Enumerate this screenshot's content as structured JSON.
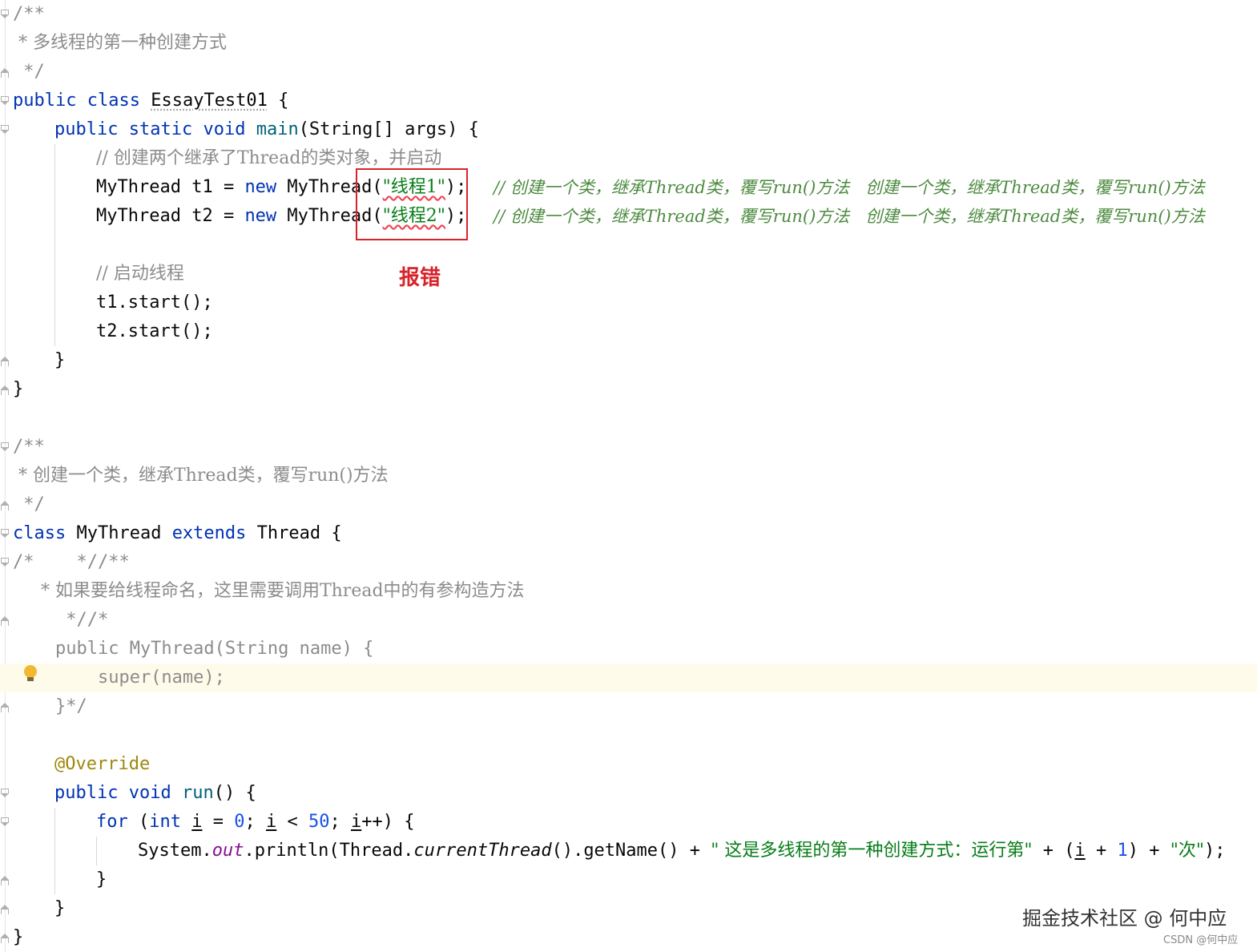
{
  "code": {
    "l1": "/**",
    "l2": " * 多线程的第一种创建方式",
    "l3": " */",
    "l4_public": "public",
    "l4_class": "class",
    "l4_name": "EssayTest01",
    "l4_brace": " {",
    "l5_public": "public",
    "l5_static": "static",
    "l5_void": "void",
    "l5_main": "main",
    "l5_rest": "(String[] args) {",
    "l6": "// 创建两个继承了Thread的类对象，并启动",
    "l7_a": "MyThread t1 = ",
    "l7_new": "new",
    "l7_b": " MyThread(",
    "l7_str": "\"线程1\"",
    "l7_c": ");",
    "l7_cm": "// 创建一个类，继承Thread类，覆写run()方法   创建一个类，继承Thread类，覆写run()方法",
    "l8_a": "MyThread t2 = ",
    "l8_new": "new",
    "l8_b": " MyThread(",
    "l8_str": "\"线程2\"",
    "l8_c": ");",
    "l8_cm": "// 创建一个类，继承Thread类，覆写run()方法   创建一个类，继承Thread类，覆写run()方法",
    "l10": "// 启动线程",
    "l11": "t1.start();",
    "l12": "t2.start();",
    "l13": "}",
    "l14": "}",
    "l16": "/**",
    "l17": " * 创建一个类，继承Thread类，覆写run()方法",
    "l18": " */",
    "l19_class": "class",
    "l19_name": " MyThread ",
    "l19_extends": "extends",
    "l19_rest": " Thread {",
    "l20": "/*    *//**",
    "l21": "     * 如果要给线程命名，这里需要调用Thread中的有参构造方法",
    "l22": "     *//*",
    "l23": "    public MyThread(String name) {",
    "l24": "        super(name);",
    "l25": "    }*/",
    "l27": "@Override",
    "l28_public": "public",
    "l28_void": "void",
    "l28_run": "run",
    "l28_rest": "() {",
    "l29_for": "for",
    "l29_a": " (",
    "l29_int": "int",
    "l29_i1": "i",
    "l29_b": " = ",
    "l29_zero": "0",
    "l29_c": "; ",
    "l29_i2": "i",
    "l29_d": " < ",
    "l29_fifty": "50",
    "l29_e": "; ",
    "l29_i3": "i",
    "l29_f": "++) {",
    "l30_a": "System.",
    "l30_out": "out",
    "l30_b": ".println(Thread.",
    "l30_ct": "currentThread",
    "l30_c": "().getName() + ",
    "l30_str": "\" 这是多线程的第一种创建方式：运行第\"",
    "l30_d": " + (",
    "l30_i": "i",
    "l30_e": " + ",
    "l30_one": "1",
    "l30_f": ") + ",
    "l30_str2": "\"次\"",
    "l30_g": ");",
    "l31": "}",
    "l32": "}",
    "l33": "}"
  },
  "annotation": {
    "error_label": "报错",
    "error_box_color": "#d8232a"
  },
  "watermark": {
    "main": "掘金技术社区 @ 何中应",
    "sub": "CSDN @何中应"
  },
  "icons": {
    "intention": "lightbulb-icon",
    "fold": "fold-arrow-icon"
  }
}
